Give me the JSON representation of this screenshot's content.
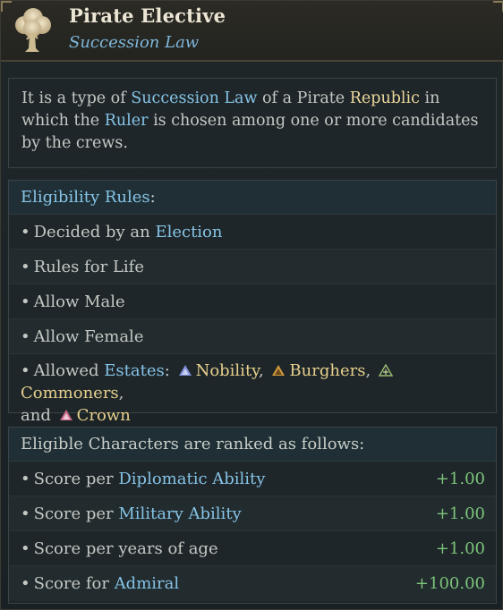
{
  "header": {
    "title": "Pirate Elective",
    "subtitle": "Succession Law",
    "icon": "tree-icon"
  },
  "description": {
    "t1": "It is a type of ",
    "h1": "Succession Law",
    "t2": " of a Pirate ",
    "h2": "Republic",
    "t3": " in which the ",
    "h3": "Ruler",
    "t4": " is chosen among one or more candidates by the crews."
  },
  "eligibility": {
    "heading": "Eligibility Rules",
    "heading_suffix": ":",
    "rules": [
      {
        "text": "Decided by an ",
        "link": "Election"
      },
      {
        "text": "Rules for Life"
      },
      {
        "text": "Allow Male"
      },
      {
        "text": "Allow Female"
      }
    ],
    "estates": {
      "prefix": "Allowed ",
      "link": "Estates",
      "colon": ":",
      "and": "and",
      "items": [
        {
          "name": "Nobility",
          "icon": "nobility-icon",
          "color": "#8a9ae0"
        },
        {
          "name": "Burghers",
          "icon": "burghers-icon",
          "color": "#d8a040"
        },
        {
          "name": "Commoners",
          "icon": "commoners-icon",
          "color": "#9ab870"
        },
        {
          "name": "Crown",
          "icon": "crown-icon",
          "color": "#d07890"
        }
      ]
    }
  },
  "ranking": {
    "heading": "Eligible Characters are ranked as follows:",
    "rows": [
      {
        "prefix": "Score per ",
        "link": "Diplomatic Ability",
        "value": "+1.00"
      },
      {
        "prefix": "Score per ",
        "link": "Military Ability",
        "value": "+1.00"
      },
      {
        "prefix": "Score per years of age",
        "link": "",
        "value": "+1.00"
      },
      {
        "prefix": "Score for ",
        "link": "Admiral",
        "value": "+100.00"
      }
    ]
  },
  "bullet": "•",
  "colors": {
    "link": "#86c3e6",
    "highlight": "#ecd89c",
    "positive": "#7cc47a"
  }
}
